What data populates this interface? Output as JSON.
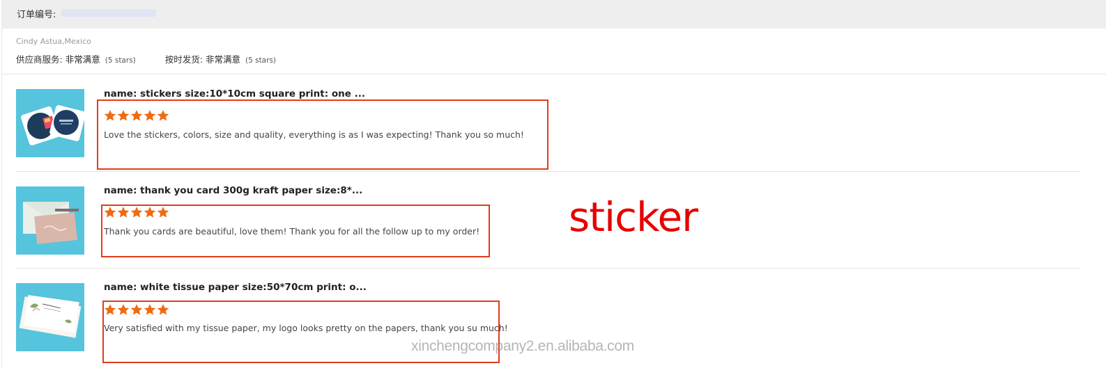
{
  "order": {
    "label": "订单编号:"
  },
  "buyer": {
    "name": "Cindy Astua,Mexico"
  },
  "ratings": {
    "supplier_service": {
      "label": "供应商服务:",
      "value": "非常满意",
      "stars_note": "(5 stars)"
    },
    "on_time_delivery": {
      "label": "按时发货:",
      "value": "非常满意",
      "stars_note": "(5 stars)"
    }
  },
  "reviews": [
    {
      "name": "name: stickers size:10*10cm square print: one ...",
      "stars": 5,
      "text": "Love the stickers, colors, size and quality, everything is as I was expecting! Thank you so much!"
    },
    {
      "name": "name: thank you card 300g kraft paper size:8*...",
      "stars": 5,
      "text": "Thank you cards are beautiful, love them! Thank you for all the follow up to my order!"
    },
    {
      "name": "name: white tissue paper size:50*70cm print: o...",
      "stars": 5,
      "text": "Very satisfied with my tissue paper, my logo looks pretty on the papers, thank you su much!"
    }
  ],
  "overlay_text": "sticker",
  "watermark": "xinchengcompany2.en.alibaba.com",
  "colors": {
    "star": "#f06a12",
    "highlight_box": "#e33a1a",
    "overlay_text": "#e60000",
    "thumb_bg": "#4fc3dc"
  },
  "icons": [
    "star-icon"
  ]
}
